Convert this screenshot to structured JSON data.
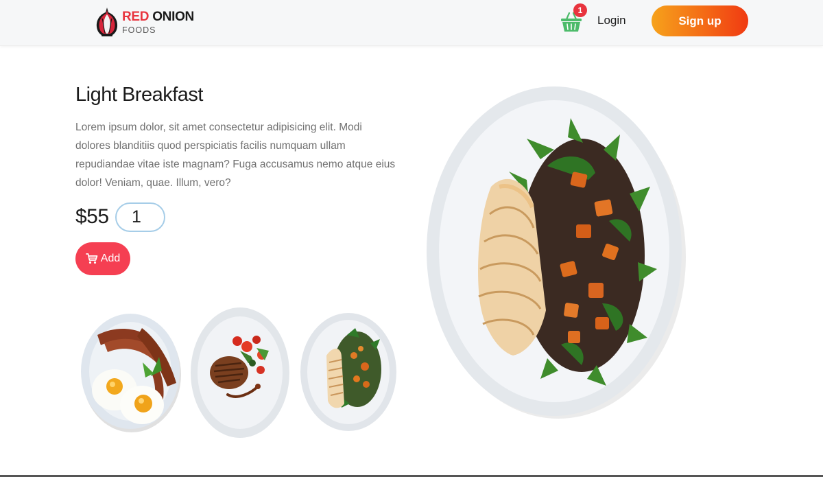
{
  "header": {
    "logo": {
      "line1_red": "RED",
      "line1_dark": "ONION",
      "line2": "FOODS"
    },
    "cart": {
      "count": "1"
    },
    "login_label": "Login",
    "signup_label": "Sign up"
  },
  "product": {
    "title": "Light Breakfast",
    "description": "Lorem ipsum dolor, sit amet consectetur adipisicing elit. Modi dolores blanditiis quod perspiciatis facilis numquam ullam repudiandae vitae iste magnam? Fuga accusamus nemo atque eius dolor! Veniam, quae. Illum, vero?",
    "price": "$55",
    "quantity": "1",
    "add_label": "Add"
  },
  "icons": {
    "logo": "red-onion-icon",
    "cart": "shopping-basket-icon",
    "add": "cart-icon"
  },
  "colors": {
    "brand_red": "#e8343e",
    "add_button": "#f53f52",
    "signup_gradient_start": "#f6a21b",
    "signup_gradient_end": "#f03a12",
    "cart_green": "#4cbb6a"
  }
}
